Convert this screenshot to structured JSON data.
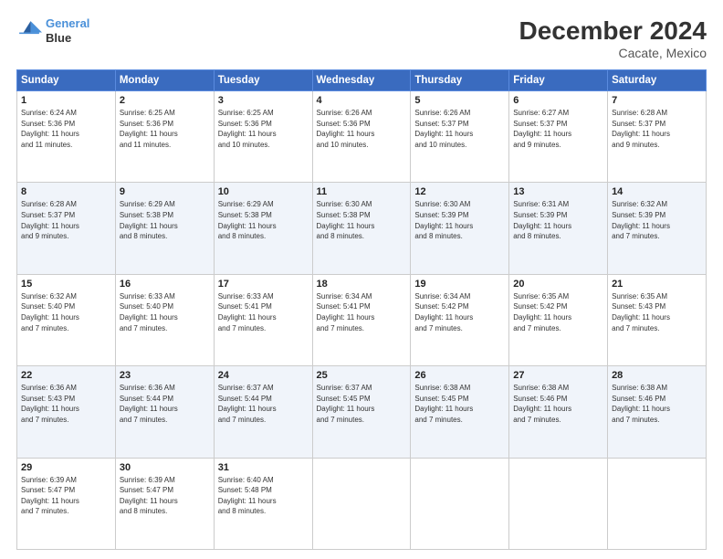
{
  "header": {
    "logo_line1": "General",
    "logo_line2": "Blue",
    "title": "December 2024",
    "subtitle": "Cacate, Mexico"
  },
  "days_of_week": [
    "Sunday",
    "Monday",
    "Tuesday",
    "Wednesday",
    "Thursday",
    "Friday",
    "Saturday"
  ],
  "weeks": [
    [
      {
        "day": "1",
        "info": "Sunrise: 6:24 AM\nSunset: 5:36 PM\nDaylight: 11 hours\nand 11 minutes."
      },
      {
        "day": "2",
        "info": "Sunrise: 6:25 AM\nSunset: 5:36 PM\nDaylight: 11 hours\nand 11 minutes."
      },
      {
        "day": "3",
        "info": "Sunrise: 6:25 AM\nSunset: 5:36 PM\nDaylight: 11 hours\nand 10 minutes."
      },
      {
        "day": "4",
        "info": "Sunrise: 6:26 AM\nSunset: 5:36 PM\nDaylight: 11 hours\nand 10 minutes."
      },
      {
        "day": "5",
        "info": "Sunrise: 6:26 AM\nSunset: 5:37 PM\nDaylight: 11 hours\nand 10 minutes."
      },
      {
        "day": "6",
        "info": "Sunrise: 6:27 AM\nSunset: 5:37 PM\nDaylight: 11 hours\nand 9 minutes."
      },
      {
        "day": "7",
        "info": "Sunrise: 6:28 AM\nSunset: 5:37 PM\nDaylight: 11 hours\nand 9 minutes."
      }
    ],
    [
      {
        "day": "8",
        "info": "Sunrise: 6:28 AM\nSunset: 5:37 PM\nDaylight: 11 hours\nand 9 minutes."
      },
      {
        "day": "9",
        "info": "Sunrise: 6:29 AM\nSunset: 5:38 PM\nDaylight: 11 hours\nand 8 minutes."
      },
      {
        "day": "10",
        "info": "Sunrise: 6:29 AM\nSunset: 5:38 PM\nDaylight: 11 hours\nand 8 minutes."
      },
      {
        "day": "11",
        "info": "Sunrise: 6:30 AM\nSunset: 5:38 PM\nDaylight: 11 hours\nand 8 minutes."
      },
      {
        "day": "12",
        "info": "Sunrise: 6:30 AM\nSunset: 5:39 PM\nDaylight: 11 hours\nand 8 minutes."
      },
      {
        "day": "13",
        "info": "Sunrise: 6:31 AM\nSunset: 5:39 PM\nDaylight: 11 hours\nand 8 minutes."
      },
      {
        "day": "14",
        "info": "Sunrise: 6:32 AM\nSunset: 5:39 PM\nDaylight: 11 hours\nand 7 minutes."
      }
    ],
    [
      {
        "day": "15",
        "info": "Sunrise: 6:32 AM\nSunset: 5:40 PM\nDaylight: 11 hours\nand 7 minutes."
      },
      {
        "day": "16",
        "info": "Sunrise: 6:33 AM\nSunset: 5:40 PM\nDaylight: 11 hours\nand 7 minutes."
      },
      {
        "day": "17",
        "info": "Sunrise: 6:33 AM\nSunset: 5:41 PM\nDaylight: 11 hours\nand 7 minutes."
      },
      {
        "day": "18",
        "info": "Sunrise: 6:34 AM\nSunset: 5:41 PM\nDaylight: 11 hours\nand 7 minutes."
      },
      {
        "day": "19",
        "info": "Sunrise: 6:34 AM\nSunset: 5:42 PM\nDaylight: 11 hours\nand 7 minutes."
      },
      {
        "day": "20",
        "info": "Sunrise: 6:35 AM\nSunset: 5:42 PM\nDaylight: 11 hours\nand 7 minutes."
      },
      {
        "day": "21",
        "info": "Sunrise: 6:35 AM\nSunset: 5:43 PM\nDaylight: 11 hours\nand 7 minutes."
      }
    ],
    [
      {
        "day": "22",
        "info": "Sunrise: 6:36 AM\nSunset: 5:43 PM\nDaylight: 11 hours\nand 7 minutes."
      },
      {
        "day": "23",
        "info": "Sunrise: 6:36 AM\nSunset: 5:44 PM\nDaylight: 11 hours\nand 7 minutes."
      },
      {
        "day": "24",
        "info": "Sunrise: 6:37 AM\nSunset: 5:44 PM\nDaylight: 11 hours\nand 7 minutes."
      },
      {
        "day": "25",
        "info": "Sunrise: 6:37 AM\nSunset: 5:45 PM\nDaylight: 11 hours\nand 7 minutes."
      },
      {
        "day": "26",
        "info": "Sunrise: 6:38 AM\nSunset: 5:45 PM\nDaylight: 11 hours\nand 7 minutes."
      },
      {
        "day": "27",
        "info": "Sunrise: 6:38 AM\nSunset: 5:46 PM\nDaylight: 11 hours\nand 7 minutes."
      },
      {
        "day": "28",
        "info": "Sunrise: 6:38 AM\nSunset: 5:46 PM\nDaylight: 11 hours\nand 7 minutes."
      }
    ],
    [
      {
        "day": "29",
        "info": "Sunrise: 6:39 AM\nSunset: 5:47 PM\nDaylight: 11 hours\nand 7 minutes."
      },
      {
        "day": "30",
        "info": "Sunrise: 6:39 AM\nSunset: 5:47 PM\nDaylight: 11 hours\nand 8 minutes."
      },
      {
        "day": "31",
        "info": "Sunrise: 6:40 AM\nSunset: 5:48 PM\nDaylight: 11 hours\nand 8 minutes."
      },
      null,
      null,
      null,
      null
    ]
  ]
}
